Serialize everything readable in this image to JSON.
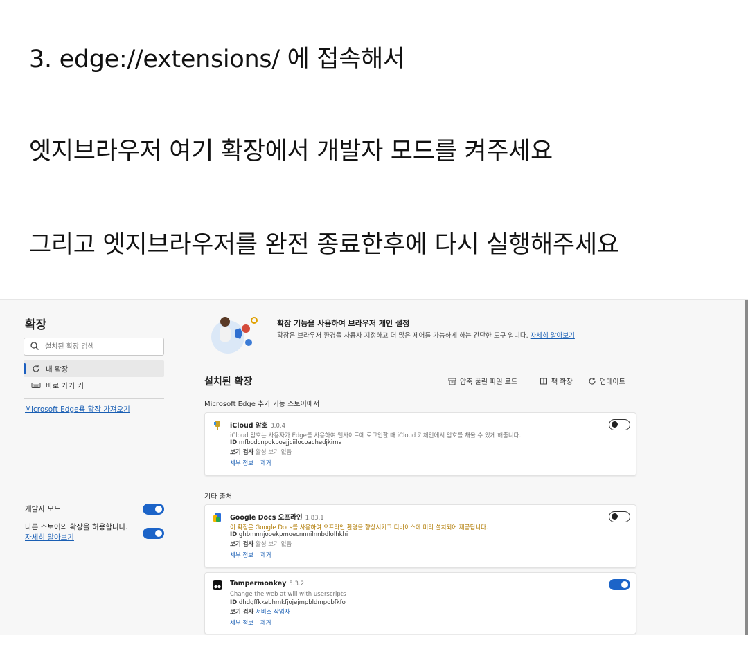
{
  "instructions": {
    "line1": "3. edge://extensions/ 에 접속해서",
    "line2": "엣지브라우저 여기 확장에서 개발자 모드를 켜주세요",
    "line3": "그리고 엣지브라우저를 완전 종료한후에 다시 실행해주세요"
  },
  "sidebar": {
    "title": "확장",
    "search_placeholder": "설치된 확장 검색",
    "items": [
      {
        "label": "내 확장",
        "icon": "refresh-icon"
      },
      {
        "label": "바로 가기 키",
        "icon": "keyboard-icon"
      }
    ],
    "store_link": "Microsoft Edge용 확장 가져오기",
    "dev_mode_label": "개발자 모드",
    "dev_mode_on": true,
    "allow_other_label": "다른 스토어의 확장을 허용합니다.",
    "allow_other_link": "자세히 알아보기",
    "allow_other_on": true
  },
  "main": {
    "hero_title": "확장 기능을 사용하여 브라우저 개인 설정",
    "hero_desc": "확장은 브라우저 환경을 사용자 지정하고 더 많은 제어를 가능하게 하는 간단한 도구 입니다.",
    "hero_link": "자세히 알아보기",
    "installed_title": "설치된 확장",
    "toolbar": {
      "load_unpacked": "압축 풀린 파일 로드",
      "pack": "팩 확장",
      "update": "업데이트"
    },
    "section_store": "Microsoft Edge 추가 기능 스토어에서",
    "section_other": "기타 출처",
    "extensions": [
      {
        "name": "iCloud 암호",
        "version": "3.0.4",
        "desc": "iCloud 암호는 사용자가 Edge를 사용하여 웹사이트에 로그인할 때 iCloud 키체인에서 암호를 채울 수 있게 해줍니다.",
        "id_label": "ID",
        "id": "mfbcdcnpokpoajjciilocoachedjkima",
        "inspect_label": "보기 검사",
        "inspect_value": "활성 보기 없음",
        "details": "세부 정보",
        "remove": "제거",
        "enabled": false,
        "icon": "key-icon"
      },
      {
        "name": "Google Docs 오프라인",
        "version": "1.83.1",
        "desc": "이 확장은 Google Docs를 사용하여 오프라인 환경을 향상시키고 디바이스에 미리 설치되어 제공됩니다.",
        "id_label": "ID",
        "id": "ghbmnnjooekpmoecnnnilnnbdlolhkhi",
        "inspect_label": "보기 검사",
        "inspect_value": "활성 보기 없음",
        "details": "세부 정보",
        "remove": "제거",
        "enabled": false,
        "icon": "google-docs-icon"
      },
      {
        "name": "Tampermonkey",
        "version": "5.3.2",
        "desc": "Change the web at will with userscripts",
        "id_label": "ID",
        "id": "dhdgffkkebhmkfjojejmpbldmpobfkfo",
        "inspect_label": "보기 검사",
        "inspect_value": "서비스 작업자",
        "details": "세부 정보",
        "remove": "제거",
        "enabled": true,
        "icon": "tampermonkey-icon"
      }
    ]
  },
  "colors": {
    "accent": "#1c64c8",
    "link": "#1a5fb4",
    "warning_text": "#b07a00"
  }
}
